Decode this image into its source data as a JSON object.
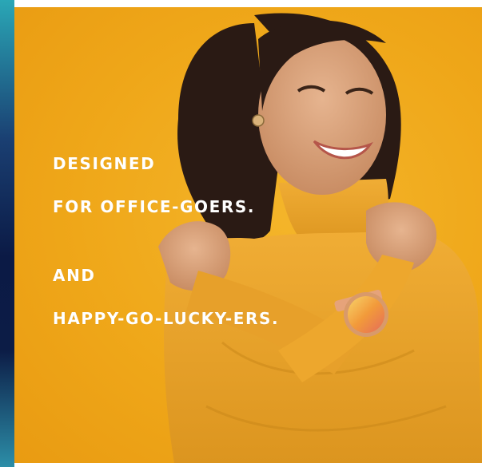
{
  "ad": {
    "headline_lines": [
      "DESIGNED",
      "FOR OFFICE-GOERS.",
      "AND",
      "HAPPY-GO-LUCKY-ERS."
    ],
    "background_color": "#F0A91C",
    "sweater_color": "#E9A12B",
    "text_color": "#FFFFFF"
  }
}
